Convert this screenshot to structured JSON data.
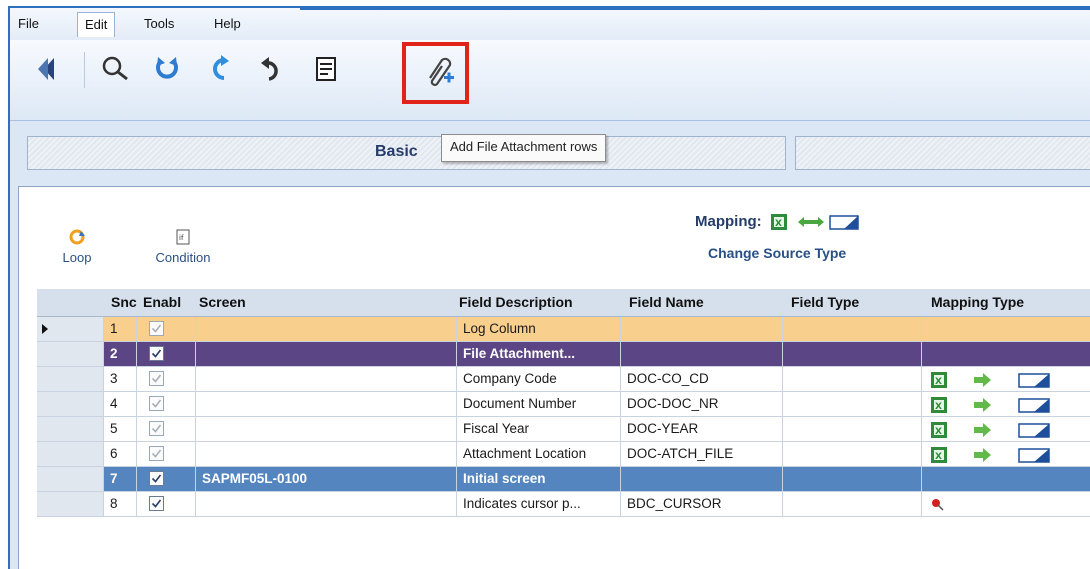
{
  "menu": {
    "items": [
      "File",
      "Edit",
      "Tools",
      "Help"
    ],
    "active": "Edit"
  },
  "toolbar": {
    "buttons": [
      {
        "name": "back-icon"
      },
      {
        "name": "find-icon"
      },
      {
        "name": "refresh-icon"
      },
      {
        "name": "redo-icon"
      },
      {
        "name": "undo-icon"
      },
      {
        "name": "script-icon"
      },
      {
        "name": "paperclip-add-icon"
      }
    ],
    "tooltip": "Add File Attachment rows",
    "highlight_color": "#e1241a"
  },
  "tabs": {
    "active_label": "Basic"
  },
  "panel": {
    "loop_label": "Loop",
    "condition_label": "Condition",
    "mapping_label": "Mapping:",
    "change_source_label": "Change Source Type"
  },
  "grid": {
    "columns": [
      "Snc",
      "Enabl",
      "Screen",
      "Field Description",
      "Field Name",
      "Field Type",
      "Mapping Type"
    ],
    "rows": [
      {
        "sno": "1",
        "enabled": true,
        "disabled_check": true,
        "screen": "",
        "description": "Log Column",
        "field_name": "",
        "field_type": "",
        "mapping": "none",
        "style": "orange"
      },
      {
        "sno": "2",
        "enabled": true,
        "disabled_check": false,
        "screen": "",
        "description": "File Attachment...",
        "field_name": "",
        "field_type": "",
        "mapping": "none",
        "style": "purple"
      },
      {
        "sno": "3",
        "enabled": true,
        "disabled_check": true,
        "screen": "",
        "description": "Company Code",
        "field_name": "DOC-CO_CD",
        "field_type": "",
        "mapping": "excel",
        "style": "normal"
      },
      {
        "sno": "4",
        "enabled": true,
        "disabled_check": true,
        "screen": "",
        "description": "Document Number",
        "field_name": "DOC-DOC_NR",
        "field_type": "",
        "mapping": "excel",
        "style": "normal"
      },
      {
        "sno": "5",
        "enabled": true,
        "disabled_check": true,
        "screen": "",
        "description": "Fiscal Year",
        "field_name": "DOC-YEAR",
        "field_type": "",
        "mapping": "excel",
        "style": "normal"
      },
      {
        "sno": "6",
        "enabled": true,
        "disabled_check": true,
        "screen": "",
        "description": "Attachment Location",
        "field_name": "DOC-ATCH_FILE",
        "field_type": "",
        "mapping": "excel",
        "style": "normal"
      },
      {
        "sno": "7",
        "enabled": true,
        "disabled_check": false,
        "screen": "SAPMF05L-0100",
        "description": "Initial screen",
        "field_name": "",
        "field_type": "",
        "mapping": "none",
        "style": "blue"
      },
      {
        "sno": "8",
        "enabled": true,
        "disabled_check": false,
        "screen": "",
        "description": "Indicates cursor p...",
        "field_name": "BDC_CURSOR",
        "field_type": "",
        "mapping": "pin",
        "style": "normal"
      }
    ]
  },
  "colors": {
    "orange_row": "#f9cf8e",
    "purple_row": "#5c4585",
    "blue_row": "#5585be",
    "accent_text": "#253c6b"
  }
}
